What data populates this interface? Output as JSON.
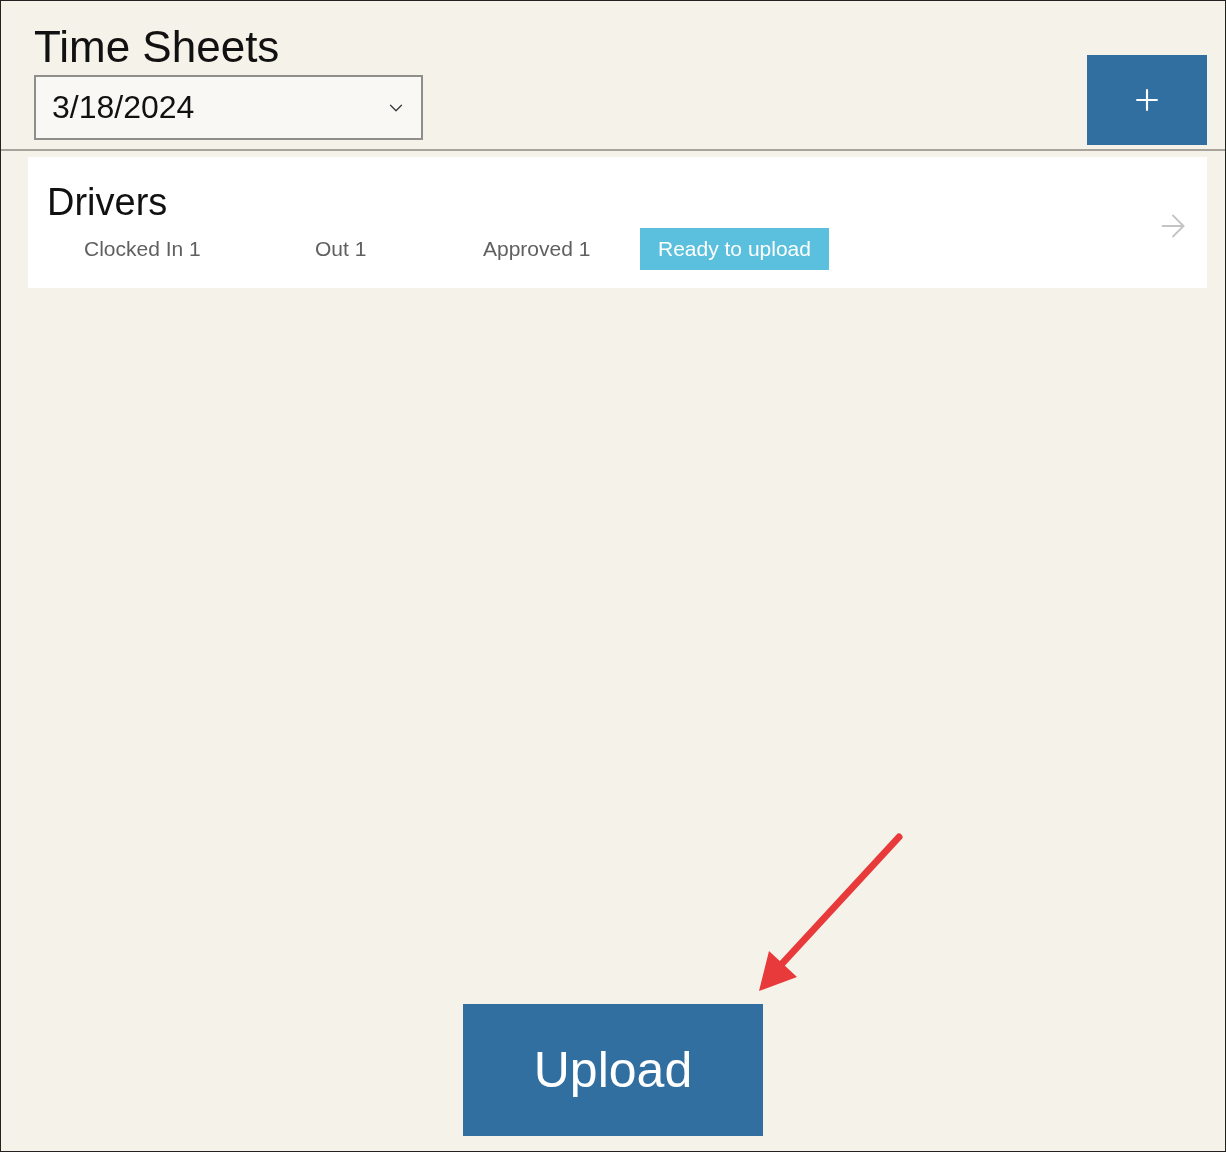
{
  "title": "Time Sheets",
  "date_picker": {
    "value": "3/18/2024"
  },
  "groups": [
    {
      "name": "Drivers",
      "stats": [
        {
          "label": "Clocked In 1",
          "kind": "count"
        },
        {
          "label": "Out 1",
          "kind": "count"
        },
        {
          "label": "Approved 1",
          "kind": "count"
        },
        {
          "label": "Ready to upload",
          "kind": "badge"
        }
      ]
    }
  ],
  "upload_button": {
    "label": "Upload"
  }
}
